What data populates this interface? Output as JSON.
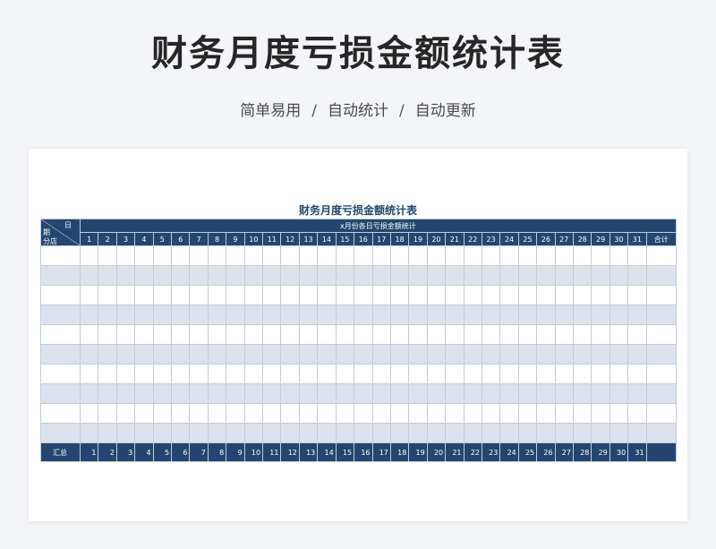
{
  "header": {
    "title": "财务月度亏损金额统计表",
    "tags": [
      "简单易用",
      "自动统计",
      "自动更新"
    ],
    "separator": "/"
  },
  "sheet": {
    "title": "财务月度亏损金额统计表",
    "group_header": "x月份各日亏损金额统计",
    "corner_day": "日",
    "corner_shop": "期\n分店",
    "days": [
      "1",
      "2",
      "3",
      "4",
      "5",
      "6",
      "7",
      "8",
      "9",
      "10",
      "11",
      "12",
      "13",
      "14",
      "15",
      "16",
      "17",
      "18",
      "19",
      "20",
      "21",
      "22",
      "23",
      "24",
      "25",
      "26",
      "27",
      "28",
      "29",
      "30",
      "31"
    ],
    "total_label": "合计",
    "summary_label": "汇总",
    "data_rows": 10,
    "colors": {
      "header_bg": "#22466f",
      "stripe": "#dde3ee",
      "border": "#c3ccd8"
    }
  }
}
